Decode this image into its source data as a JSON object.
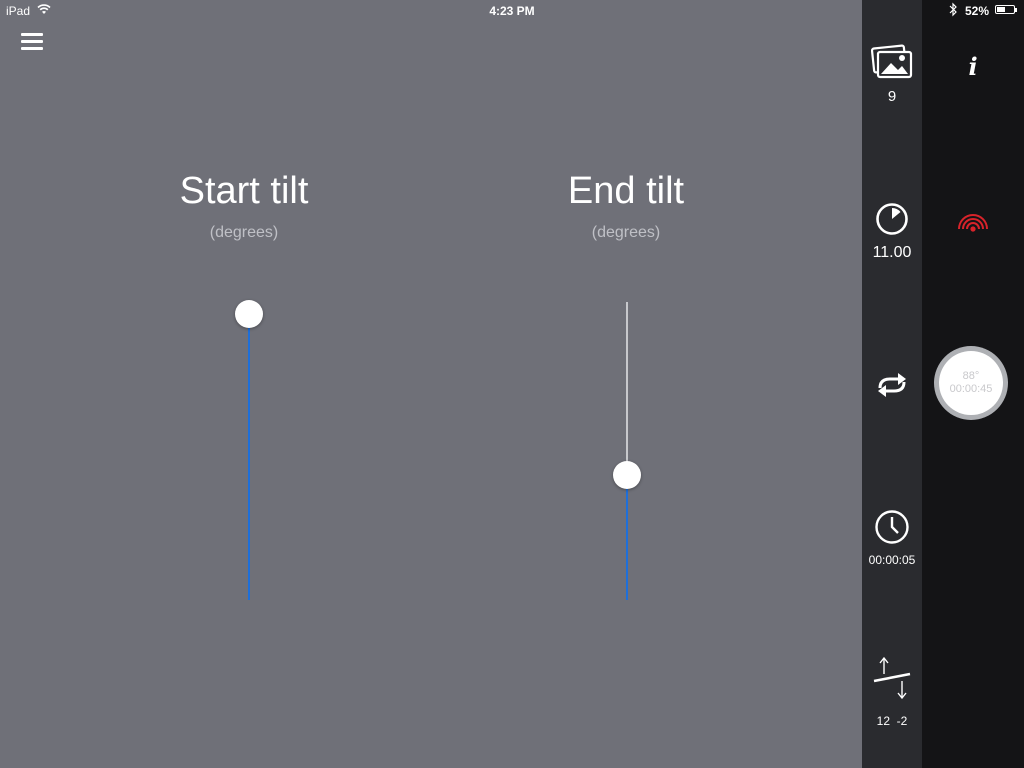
{
  "status_bar": {
    "device": "iPad",
    "time": "4:23 PM",
    "battery": "52%",
    "battery_level": 0.52
  },
  "icons": {
    "menu": "hamburger-icon",
    "wifi": "wifi-icon",
    "bluetooth": "bluetooth-icon",
    "photos": "photos-icon",
    "interval": "timer-dial-icon",
    "loop": "repeat-icon",
    "duration": "clock-icon",
    "tilt": "tilt-arrows-icon",
    "info": "info-icon",
    "signal": "signal-icon"
  },
  "colors": {
    "background": "#6f7078",
    "accent_blue": "#1e6fd9",
    "signal_red": "#d8232a",
    "sidebar": "#2a2b2f",
    "panel": "#141416"
  },
  "sliders": {
    "start_tilt": {
      "title": "Start tilt",
      "unit": "(degrees)",
      "position": 0.96
    },
    "end_tilt": {
      "title": "End tilt",
      "unit": "(degrees)",
      "position": 0.42
    }
  },
  "sidebar": {
    "photos_count": "9",
    "interval": "11.00",
    "duration": "00:00:05",
    "tilt_start": "12",
    "tilt_end": "-2"
  },
  "start_button": {
    "angle": "88°",
    "time": "00:00:45"
  }
}
